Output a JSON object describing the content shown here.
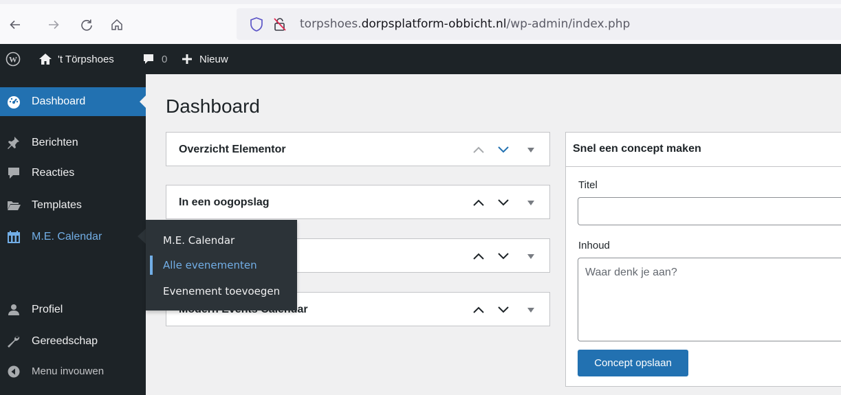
{
  "browser": {
    "url_prefix": "torpshoes.",
    "url_domain": "dorpsplatform-obbicht.nl",
    "url_path": "/wp-admin/index.php",
    "icons": [
      "back-arrow-icon",
      "forward-arrow-icon",
      "reload-icon",
      "home-icon",
      "shield-icon",
      "insecure-lock-icon"
    ]
  },
  "adminbar": {
    "site_name": "'t Törpshoes",
    "comments_count": "0",
    "new_label": "Nieuw"
  },
  "sidebar": {
    "items": [
      {
        "label": "Dashboard",
        "icon": "dashboard-icon"
      },
      {
        "label": "Berichten",
        "icon": "pin-icon"
      },
      {
        "label": "Reacties",
        "icon": "comment-icon"
      },
      {
        "label": "Templates",
        "icon": "folder-icon"
      },
      {
        "label": "M.E. Calendar",
        "icon": "calendar-icon"
      },
      {
        "label": "Profiel",
        "icon": "user-icon"
      },
      {
        "label": "Gereedschap",
        "icon": "wrench-icon"
      },
      {
        "label": "Menu invouwen",
        "icon": "collapse-icon"
      }
    ]
  },
  "flyout": {
    "items": [
      "M.E. Calendar",
      "Alle evenementen",
      "Evenement toevoegen"
    ]
  },
  "main": {
    "title": "Dashboard",
    "widgets": [
      {
        "title": "Overzicht Elementor"
      },
      {
        "title": "In een oogopslag"
      },
      {
        "title": ""
      },
      {
        "title": "Modern Events Calendar"
      }
    ]
  },
  "draft": {
    "title": "Snel een concept maken",
    "title_label": "Titel",
    "content_label": "Inhoud",
    "content_placeholder": "Waar denk je aan?",
    "save_label": "Concept opslaan"
  },
  "colors": {
    "accent": "#2271b1",
    "adminbar_bg": "#1d2327",
    "hover_blue": "#72aee6"
  }
}
